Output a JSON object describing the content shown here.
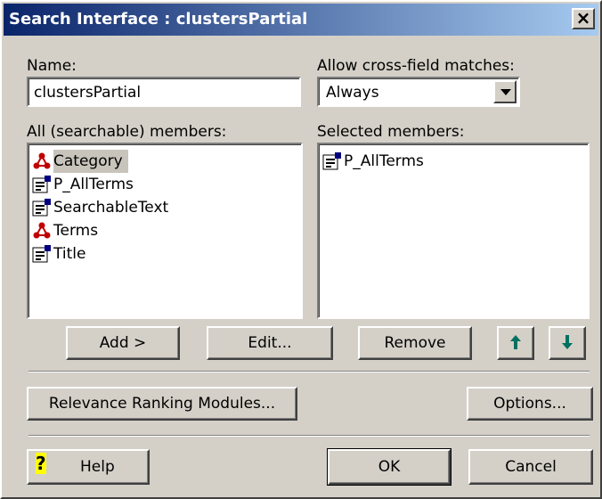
{
  "window": {
    "title": "Search Interface : clustersPartial"
  },
  "name_field": {
    "label": "Name:",
    "value": "clustersPartial"
  },
  "cross_field": {
    "label": "Allow cross-field matches:",
    "value": "Always"
  },
  "all_members": {
    "label": "All (searchable) members:",
    "items": [
      {
        "label": "Category",
        "icon": "cluster-icon"
      },
      {
        "label": "P_AllTerms",
        "icon": "property-icon"
      },
      {
        "label": "SearchableText",
        "icon": "property-icon"
      },
      {
        "label": "Terms",
        "icon": "cluster-icon"
      },
      {
        "label": "Title",
        "icon": "property-icon"
      }
    ]
  },
  "selected_members": {
    "label": "Selected members:",
    "items": [
      {
        "label": "P_AllTerms",
        "icon": "property-icon"
      }
    ]
  },
  "buttons": {
    "add": "Add >",
    "edit": "Edit...",
    "remove": "Remove",
    "relevance": "Relevance Ranking Modules...",
    "options": "Options...",
    "help": "Help",
    "ok": "OK",
    "cancel": "Cancel"
  },
  "colors": {
    "title_start": "#0a246a",
    "title_end": "#a6caf0",
    "arrow_green": "#007060"
  }
}
